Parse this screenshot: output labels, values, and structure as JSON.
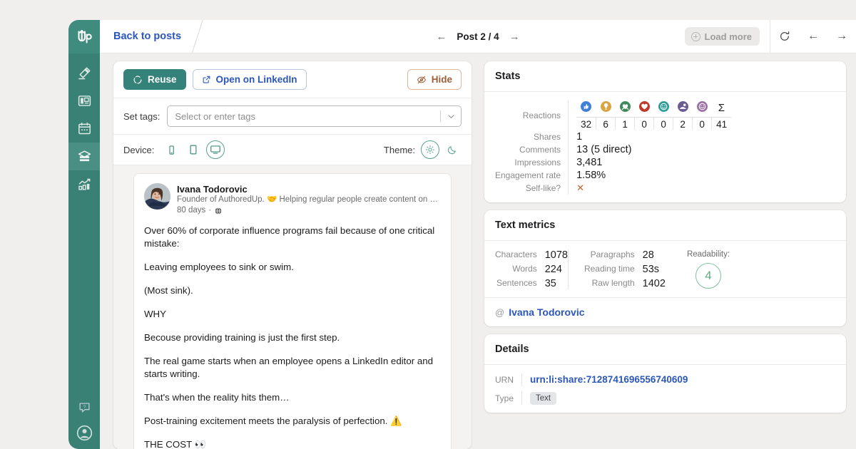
{
  "brand": {
    "logo_text": "Up",
    "accent": "#35827a",
    "sidebar_bg": "#3a8175",
    "link_blue": "#2b57b8"
  },
  "sidebar": {
    "items": [
      {
        "name": "write-post",
        "icon": "pen-icon",
        "active": false
      },
      {
        "name": "drafts",
        "icon": "blueprint-icon",
        "active": false
      },
      {
        "name": "scheduled",
        "icon": "calendar-icon",
        "active": false
      },
      {
        "name": "archive",
        "icon": "archive-box-icon",
        "active": true
      },
      {
        "name": "analytics",
        "icon": "bar-chart-icon",
        "active": false
      }
    ],
    "bottom_items": [
      {
        "name": "help",
        "icon": "help-chat-icon"
      },
      {
        "name": "account",
        "icon": "user-circle-icon"
      }
    ]
  },
  "topbar": {
    "back_label": "Back to posts",
    "prev_icon": "arrow-left-icon",
    "next_icon": "arrow-right-icon",
    "post_counter": "Post 2 / 4",
    "load_more_label": "Load more",
    "load_more_icon": "plus-circle-icon",
    "refresh_icon": "refresh-icon",
    "nav_back_icon": "arrow-left-icon",
    "nav_forward_icon": "arrow-right-icon"
  },
  "post_toolbar": {
    "reuse_label": "Reuse",
    "reuse_icon": "recycle-icon",
    "open_label": "Open on LinkedIn",
    "open_icon": "external-link-icon",
    "hide_label": "Hide",
    "hide_icon": "eye-off-icon",
    "tags_label": "Set tags:",
    "tags_value": "",
    "tags_placeholder": "Select or enter tags",
    "tags_chevron_icon": "chevron-down-icon",
    "device_label": "Device:",
    "devices": [
      {
        "name": "device-mobile",
        "icon": "mobile-icon",
        "selected": false
      },
      {
        "name": "device-tablet",
        "icon": "tablet-icon",
        "selected": false
      },
      {
        "name": "device-desktop",
        "icon": "desktop-icon",
        "selected": true
      }
    ],
    "theme_label": "Theme:",
    "themes": [
      {
        "name": "theme-light",
        "icon": "sun-icon",
        "selected": true
      },
      {
        "name": "theme-dark",
        "icon": "moon-icon",
        "selected": false
      }
    ]
  },
  "post": {
    "author_name": "Ivana Todorovic",
    "author_desc": "Founder of AuthoredUp. 🤝 Helping regular people create content on Linked…",
    "timestamp": "80 days",
    "visibility_icon": "globe-icon",
    "paragraphs": [
      "Over 60% of corporate influence programs fail because of one critical mistake:",
      "Leaving employees to sink or swim.",
      "(Most sink).",
      "WHY",
      "Becouse providing training is just the first step.",
      "The real game starts when an employee opens a LinkedIn editor and starts writing.",
      "That's when the reality hits them…",
      "Post-training excitement meets the paralysis of perfection. ⚠️",
      "THE COST 👀"
    ]
  },
  "stats": {
    "title": "Stats",
    "reactions_label": "Reactions",
    "reactions": [
      {
        "name": "reaction-like",
        "icon": "thumbs-up-icon",
        "color": "#3f7fd6",
        "count": "32"
      },
      {
        "name": "reaction-celebrate",
        "icon": "lightbulb-icon",
        "color": "#d9a544",
        "count": "6"
      },
      {
        "name": "reaction-support",
        "icon": "hands-heart-icon",
        "color": "#3f8a5a",
        "count": "1"
      },
      {
        "name": "reaction-love",
        "icon": "heart-icon",
        "color": "#c0392b",
        "count": "0"
      },
      {
        "name": "reaction-insightful",
        "icon": "face-smile-icon",
        "color": "#2a9d9a",
        "count": "0"
      },
      {
        "name": "reaction-curious",
        "icon": "curious-icon",
        "color": "#6b5b95",
        "count": "2"
      },
      {
        "name": "reaction-funny",
        "icon": "funny-icon",
        "color": "#9b6fa8",
        "count": "0"
      }
    ],
    "total_symbol": "Σ",
    "total": "41",
    "rows": [
      {
        "label": "Shares",
        "value": "1"
      },
      {
        "label": "Comments",
        "value": "13 (5 direct)"
      },
      {
        "label": "Impressions",
        "value": "3,481"
      },
      {
        "label": "Engagement rate",
        "value": "1.58%"
      }
    ],
    "self_like_label": "Self-like?",
    "self_like_value": "✕"
  },
  "text_metrics": {
    "title": "Text metrics",
    "col1": [
      {
        "label": "Characters",
        "value": "1078"
      },
      {
        "label": "Words",
        "value": "224"
      },
      {
        "label": "Sentences",
        "value": "35"
      }
    ],
    "col2": [
      {
        "label": "Paragraphs",
        "value": "28"
      },
      {
        "label": "Reading time",
        "value": "53s"
      },
      {
        "label": "Raw length",
        "value": "1402"
      }
    ],
    "readability_label": "Readability:",
    "readability_score": "4",
    "readability_color": "#7bc49b",
    "mention_at": "@",
    "mention_name": "Ivana Todorovic"
  },
  "details": {
    "title": "Details",
    "urn_label": "URN",
    "urn_value": "urn:li:share:7128741696556740609",
    "type_label": "Type",
    "type_value": "Text"
  }
}
